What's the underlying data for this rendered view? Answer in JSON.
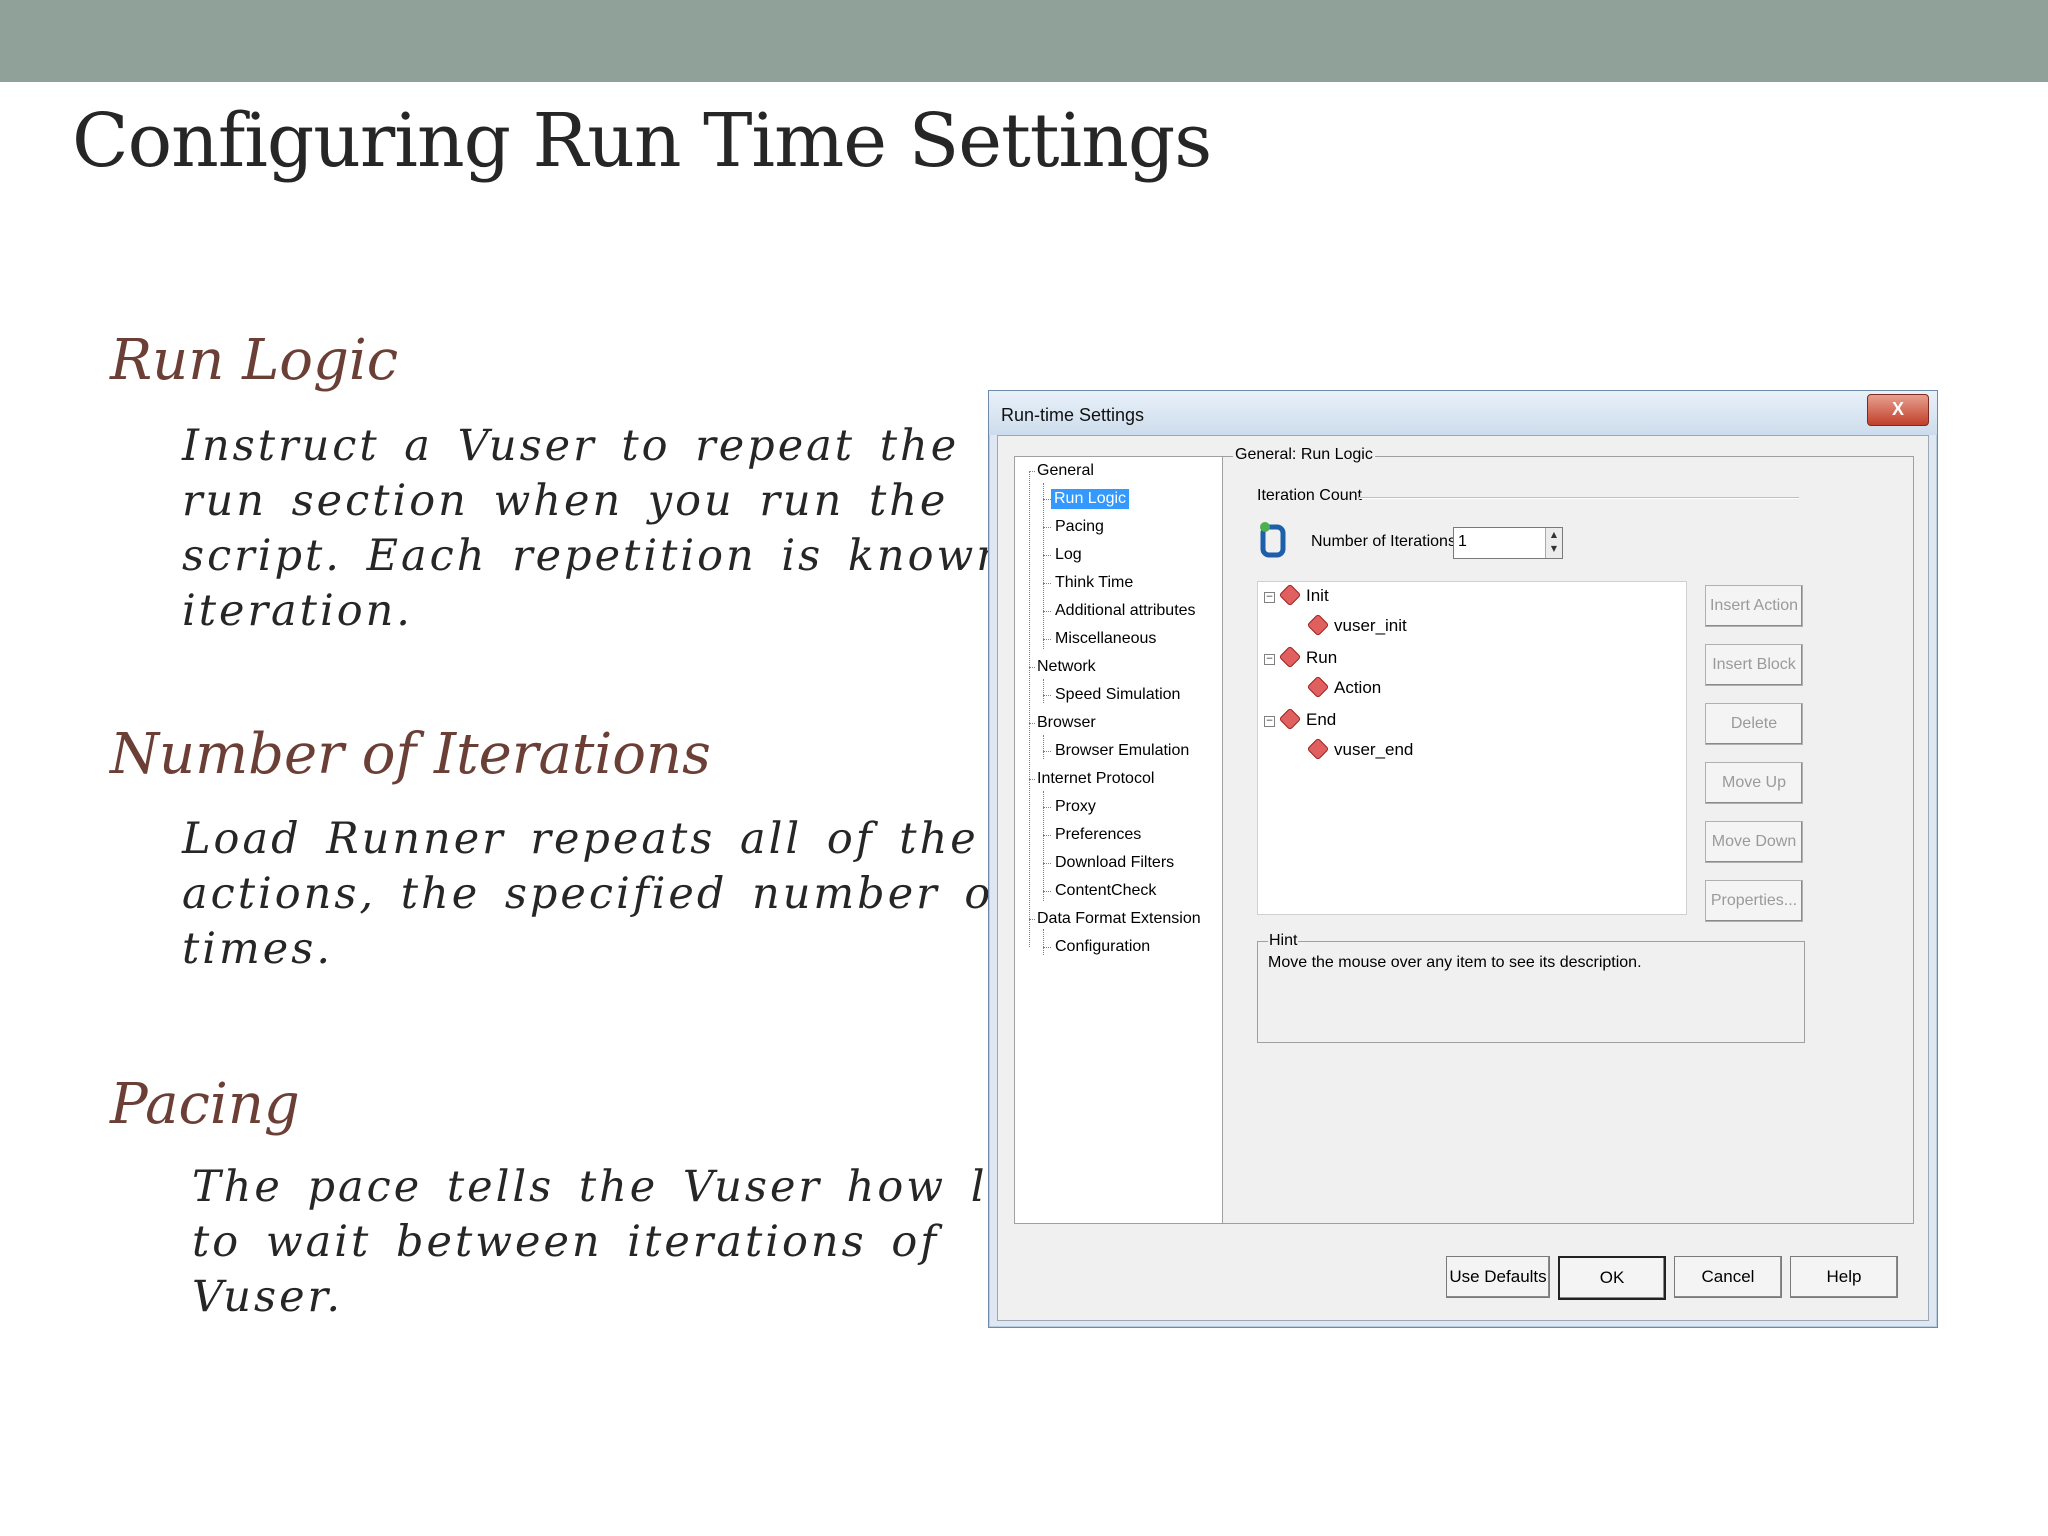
{
  "slide": {
    "title": "Configuring Run Time Settings",
    "sections": [
      {
        "heading": "Run Logic",
        "lines": [
          "Instruct a Vuser to repeat the",
          "run section when you run the",
          "script. Each repetition is known as",
          "iteration."
        ]
      },
      {
        "heading": "Number of Iterations",
        "lines": [
          "Load Runner repeats all of the",
          "actions, the specified number of",
          "times."
        ]
      },
      {
        "heading": "Pacing",
        "lines": [
          "The pace tells the Vuser how long",
          "to wait between iterations of",
          "Vuser."
        ]
      }
    ]
  },
  "dialog": {
    "title": "Run-time Settings",
    "close": "X",
    "tree": [
      "General",
      "Run Logic",
      "Pacing",
      "Log",
      "Think Time",
      "Additional attributes",
      "Miscellaneous",
      "Network",
      "Speed Simulation",
      "Browser",
      "Browser Emulation",
      "Internet Protocol",
      "Proxy",
      "Preferences",
      "Download Filters",
      "ContentCheck",
      "Data Format Extension",
      "Configuration"
    ],
    "selected": "Run Logic",
    "panel_title": "General: Run Logic",
    "iteration_count_label": "Iteration Count",
    "iterations_label": "Number of Iterations:",
    "iterations_value": "1",
    "actions": [
      "Init",
      "vuser_init",
      "Run",
      "Action",
      "End",
      "vuser_end"
    ],
    "side_buttons": [
      "Insert Action",
      "Insert Block",
      "Delete",
      "Move Up",
      "Move Down",
      "Properties..."
    ],
    "hint_title": "Hint",
    "hint_text": "Move the mouse over any item to see its description.",
    "buttons": [
      "Use Defaults",
      "OK",
      "Cancel",
      "Help"
    ]
  }
}
